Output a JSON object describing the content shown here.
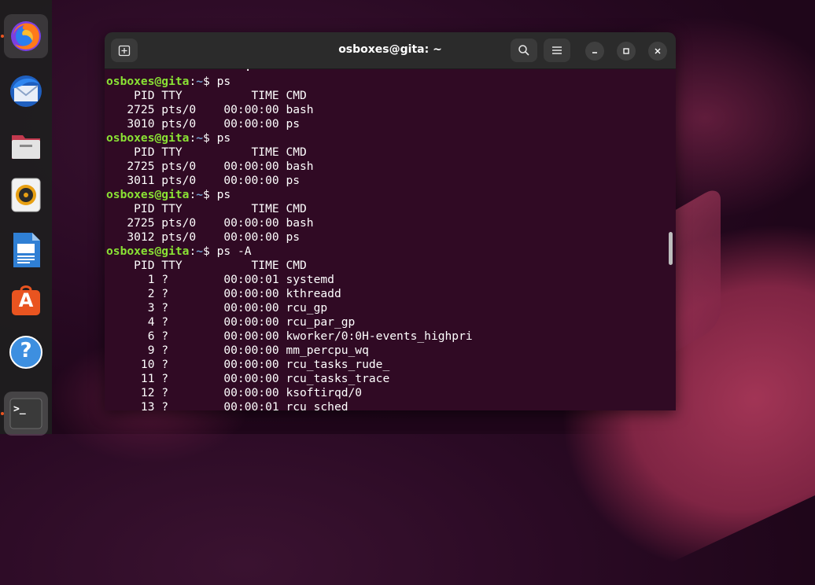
{
  "window": {
    "title": "osboxes@gita: ~"
  },
  "dock": {
    "items": [
      {
        "name": "firefox",
        "icon": "firefox-icon"
      },
      {
        "name": "thunderbird",
        "icon": "thunderbird-icon"
      },
      {
        "name": "files",
        "icon": "files-icon"
      },
      {
        "name": "rhythmbox",
        "icon": "rhythmbox-icon"
      },
      {
        "name": "libreoffice-writer",
        "icon": "writer-icon"
      },
      {
        "name": "app-center",
        "icon": "app-center-icon",
        "glyph": "A"
      },
      {
        "name": "help",
        "icon": "help-icon",
        "glyph": "?"
      },
      {
        "name": "terminal",
        "icon": "terminal-icon",
        "glyph": ">_"
      }
    ]
  },
  "terminal": {
    "prompt_user": "osboxes@gita",
    "prompt_path": "~",
    "lines": [
      {
        "type": "text",
        "text": "                    ."
      },
      {
        "type": "prompt",
        "cmd": "ps"
      },
      {
        "type": "text",
        "text": "    PID TTY          TIME CMD"
      },
      {
        "type": "text",
        "text": "   2725 pts/0    00:00:00 bash"
      },
      {
        "type": "text",
        "text": "   3010 pts/0    00:00:00 ps"
      },
      {
        "type": "prompt",
        "cmd": "ps"
      },
      {
        "type": "text",
        "text": "    PID TTY          TIME CMD"
      },
      {
        "type": "text",
        "text": "   2725 pts/0    00:00:00 bash"
      },
      {
        "type": "text",
        "text": "   3011 pts/0    00:00:00 ps"
      },
      {
        "type": "prompt",
        "cmd": "ps"
      },
      {
        "type": "text",
        "text": "    PID TTY          TIME CMD"
      },
      {
        "type": "text",
        "text": "   2725 pts/0    00:00:00 bash"
      },
      {
        "type": "text",
        "text": "   3012 pts/0    00:00:00 ps"
      },
      {
        "type": "prompt",
        "cmd": "ps -A"
      },
      {
        "type": "text",
        "text": "    PID TTY          TIME CMD"
      },
      {
        "type": "text",
        "text": "      1 ?        00:00:01 systemd"
      },
      {
        "type": "text",
        "text": "      2 ?        00:00:00 kthreadd"
      },
      {
        "type": "text",
        "text": "      3 ?        00:00:00 rcu_gp"
      },
      {
        "type": "text",
        "text": "      4 ?        00:00:00 rcu_par_gp"
      },
      {
        "type": "text",
        "text": "      6 ?        00:00:00 kworker/0:0H-events_highpri"
      },
      {
        "type": "text",
        "text": "      9 ?        00:00:00 mm_percpu_wq"
      },
      {
        "type": "text",
        "text": "     10 ?        00:00:00 rcu_tasks_rude_"
      },
      {
        "type": "text",
        "text": "     11 ?        00:00:00 rcu_tasks_trace"
      },
      {
        "type": "text",
        "text": "     12 ?        00:00:00 ksoftirqd/0"
      },
      {
        "type": "text",
        "text": "     13 ?        00:00:01 rcu_sched"
      }
    ]
  },
  "colors": {
    "terminal_bg": "#300a24",
    "prompt_user": "#8ae234",
    "prompt_path": "#729fcf",
    "dock_bg": "#1e1e1e",
    "accent": "#e95420"
  }
}
